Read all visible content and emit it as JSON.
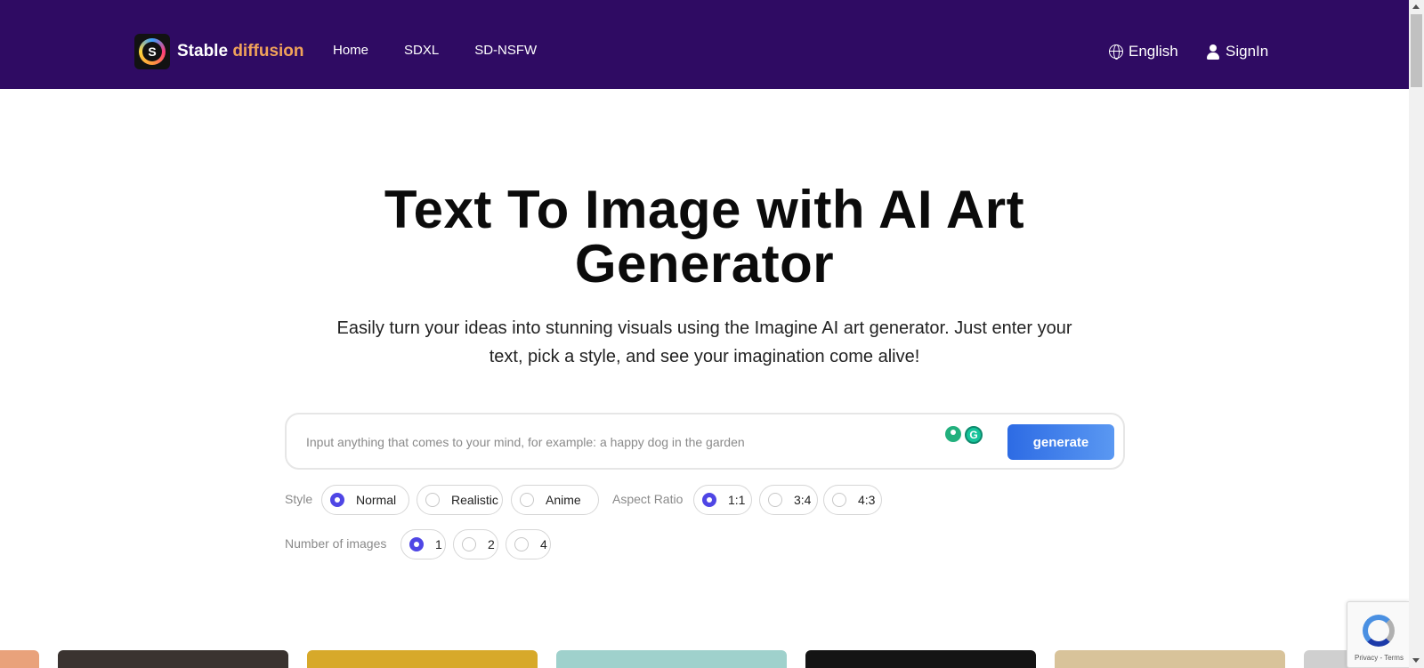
{
  "header": {
    "brand_main": "Stable",
    "brand_accent": "diffusion",
    "nav": [
      {
        "label": "Home"
      },
      {
        "label": "SDXL"
      },
      {
        "label": "SD-NSFW"
      }
    ],
    "language": "English",
    "signin": "SignIn"
  },
  "hero": {
    "title_line1": "Text To Image with AI Art",
    "title_line2": "Generator",
    "subtitle_line1": "Easily turn your ideas into stunning visuals using the Imagine AI art generator. Just enter your",
    "subtitle_line2": "text, pick a style, and see your imagination come alive!"
  },
  "prompt": {
    "placeholder": "Input anything that comes to your mind, for example: a happy dog in the garden",
    "value": "",
    "generate_label": "generate",
    "ext_letter": "G"
  },
  "options": {
    "style_label": "Style",
    "styles": [
      {
        "label": "Normal",
        "selected": true
      },
      {
        "label": "Realistic",
        "selected": false
      },
      {
        "label": "Anime",
        "selected": false
      }
    ],
    "aspect_label": "Aspect Ratio",
    "aspects": [
      {
        "label": "1:1",
        "selected": true
      },
      {
        "label": "3:4",
        "selected": false
      },
      {
        "label": "4:3",
        "selected": false
      }
    ],
    "count_label": "Number of images",
    "counts": [
      {
        "label": "1",
        "selected": true
      },
      {
        "label": "2",
        "selected": false
      },
      {
        "label": "4",
        "selected": false
      }
    ]
  },
  "gallery": {
    "tile_colors": [
      "#e9a27b",
      "#3a3330",
      "#d7a92a",
      "#9fd1cc",
      "#141414",
      "#d8c39a",
      "#cfcfcf"
    ]
  },
  "recaptcha": {
    "text": "Privacy - Terms"
  },
  "colors": {
    "header_bg": "#2f0b63",
    "brand_accent": "#f0a25a",
    "generate_button": "#2d6be4",
    "radio_selected": "#4f46e5"
  }
}
